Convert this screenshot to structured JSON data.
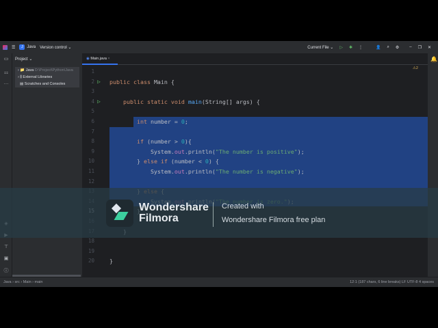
{
  "titlebar": {
    "project": "Java",
    "project_badge": "J",
    "vcs": "Version control ⌄",
    "run_config": "Current File ⌄"
  },
  "project_panel": {
    "title": "Project ⌄",
    "items": [
      {
        "label": "Java",
        "path": "D:\\Project\\Python\\Java"
      },
      {
        "label": "External Libraries"
      },
      {
        "label": "Scratches and Consoles"
      }
    ]
  },
  "tab": {
    "label": "Main.java",
    "close": "×"
  },
  "inspections": {
    "warnings": "⚠2"
  },
  "code": [
    [],
    [
      [
        "public class ",
        "k"
      ],
      [
        "Main {",
        "d"
      ]
    ],
    [],
    [
      [
        "    public static void ",
        "k"
      ],
      [
        "main",
        "m"
      ],
      [
        "(String[] args) {",
        "d"
      ]
    ],
    [],
    [
      [
        "        int ",
        "k"
      ],
      [
        "number = ",
        "d"
      ],
      [
        "0",
        "n"
      ],
      [
        ";",
        "d"
      ]
    ],
    [],
    [
      [
        "        if ",
        "k"
      ],
      [
        "(number > ",
        "d"
      ],
      [
        "0",
        "n"
      ],
      [
        "){",
        "d"
      ]
    ],
    [
      [
        "            System.",
        "d"
      ],
      [
        "out",
        "f"
      ],
      [
        ".println(",
        "d"
      ],
      [
        "\"The number is positive\"",
        "s"
      ],
      [
        ");",
        "d"
      ]
    ],
    [
      [
        "        } ",
        "d"
      ],
      [
        "else if ",
        "k"
      ],
      [
        "(number < ",
        "d"
      ],
      [
        "0",
        "n"
      ],
      [
        ") {",
        "d"
      ]
    ],
    [
      [
        "            System.",
        "d"
      ],
      [
        "out",
        "f"
      ],
      [
        ".println(",
        "d"
      ],
      [
        "\"The number is negative\"",
        "s"
      ],
      [
        ");",
        "d"
      ]
    ],
    [],
    [
      [
        "        } ",
        "d"
      ],
      [
        "else ",
        "k"
      ],
      [
        "{",
        "d"
      ]
    ],
    [
      [
        "            System.",
        "d"
      ],
      [
        "out",
        "f"
      ],
      [
        ".println(",
        "d"
      ],
      [
        "\"The number is zero.\"",
        "s"
      ],
      [
        ");",
        "d"
      ]
    ],
    [
      [
        "        }",
        "d"
      ]
    ],
    [],
    [
      [
        "    }",
        "d"
      ]
    ],
    [],
    [],
    [
      [
        "}",
        "d"
      ]
    ]
  ],
  "status": {
    "breadcrumb": "Java  ›  src  ›  Main  ›  main",
    "info": "12:1 (187 chars, 6 line breaks)   LF   UTF-8   4 spaces"
  },
  "watermark": {
    "brand_line1": "Wondershare",
    "brand_line2": "Filmora",
    "line1": "Created with",
    "line2": "Wondershare Filmora free plan"
  },
  "colors": {
    "k": "#cf8e6d",
    "d": "#bcbec4",
    "m": "#56a8f5",
    "n": "#2aacb8",
    "s": "#6aab73",
    "f": "#c77dbb",
    "accent": "#3574f0",
    "selection": "#214283"
  }
}
